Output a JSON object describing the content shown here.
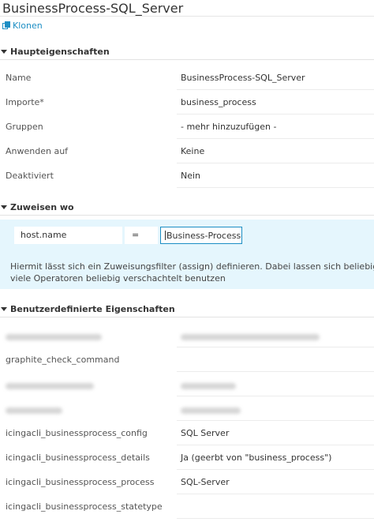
{
  "header": {
    "title": "BusinessProcess-SQL_Server",
    "clone_label": "Klonen"
  },
  "sections": {
    "main": "Haupteigenschaften",
    "assign": "Zuweisen wo",
    "custom": "Benutzerdefinierte Eigenschaften"
  },
  "main_props": [
    {
      "label": "Name",
      "value": "BusinessProcess-SQL_Server"
    },
    {
      "label": "Importe*",
      "value": "business_process"
    },
    {
      "label": "Gruppen",
      "value": "- mehr hinzuzufügen -"
    },
    {
      "label": "Anwenden auf",
      "value": "Keine"
    },
    {
      "label": "Deaktiviert",
      "value": "Nein"
    }
  ],
  "assign": {
    "property": "host.name",
    "operator": "=",
    "value": "Business-Process-D",
    "hint": "Hiermit lässt sich ein Zuweisungsfilter (assign) definieren. Dabei lassen sich beliebig viele Operatoren beliebig verschachtelt benutzen"
  },
  "custom_props": [
    {
      "label": "graphite_check_command",
      "value": ""
    },
    {
      "label": "icingacli_businessprocess_config",
      "value": "SQL Server"
    },
    {
      "label": "icingacli_businessprocess_details",
      "value": "Ja (geerbt von \"business_process\")"
    },
    {
      "label": "icingacli_businessprocess_process",
      "value": "SQL-Server"
    },
    {
      "label": "icingacli_businessprocess_statetype",
      "value": ""
    }
  ]
}
